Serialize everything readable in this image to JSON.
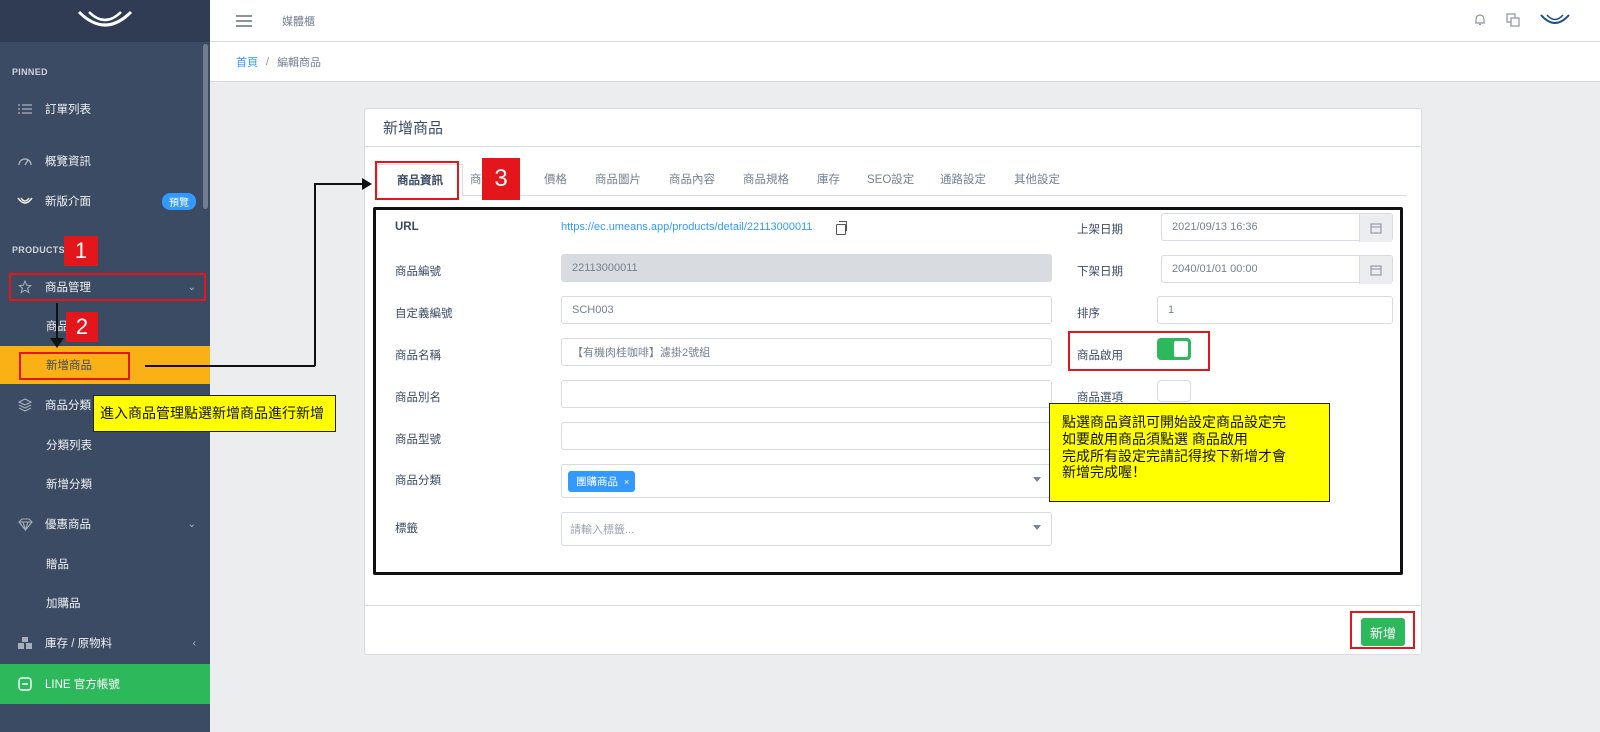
{
  "header": {
    "link": "媒體櫃"
  },
  "breadcrumb": {
    "home": "首頁",
    "separator": "/",
    "current": "編輯商品"
  },
  "sidebar": {
    "section_pinned": "PINNED",
    "section_products": "PRODUCTS",
    "items": {
      "orders": "訂單列表",
      "overview": "概覽資訊",
      "new_ui": "新版介面",
      "new_ui_badge": "預覽",
      "product_mgmt": "商品管理",
      "products_list": "商品",
      "add_product": "新增商品",
      "categories": "商品分類",
      "category_list": "分類列表",
      "add_category": "新增分類",
      "promotions": "優惠商品",
      "gifts": "贈品",
      "addon": "加購品",
      "inventory": "庫存 / 原物料",
      "line": "LINE 官方帳號"
    }
  },
  "card": {
    "title": "新增商品",
    "tabs": [
      "商品資訊",
      "商",
      "價格",
      "商品圖片",
      "商品內容",
      "商品規格",
      "庫存",
      "SEO設定",
      "通路設定",
      "其他設定"
    ],
    "submit_label": "新增"
  },
  "form": {
    "url_label": "URL",
    "url_value": "https://ec.umeans.app/products/detail/22113000011",
    "sku_label": "商品編號",
    "sku_value": "22113000011",
    "custom_label": "自定義編號",
    "custom_value": "SCH003",
    "name_label": "商品名稱",
    "name_value": "【有機肉桂咖啡】濾掛2號組",
    "alias_label": "商品別名",
    "alias_value": "",
    "model_label": "商品型號",
    "model_value": "",
    "category_label": "商品分類",
    "category_tag": "團購商品",
    "category_tag_remove": "×",
    "tags_label": "標籤",
    "tags_placeholder": "請輸入標籤...",
    "start_label": "上架日期",
    "start_value": "2021/09/13 16:36",
    "end_label": "下架日期",
    "end_value": "2040/01/01 00:00",
    "sort_label": "排序",
    "sort_value": "1",
    "enabled_label": "商品啟用",
    "enabled": true,
    "options_label": "商品選項",
    "options_enabled": false
  },
  "annotations": {
    "n1": "1",
    "n2": "2",
    "n3": "3",
    "note_left": "進入商品管理點選新增商品進行新增",
    "note_right": [
      "點選商品資訊可開始設定商品設定完",
      "如要啟用商品須點選 商品啟用",
      "完成所有設定完請記得按下新增才會",
      "新增完成喔！"
    ],
    "annotation_color": "#e3161c",
    "note_color": "#ffff00"
  }
}
